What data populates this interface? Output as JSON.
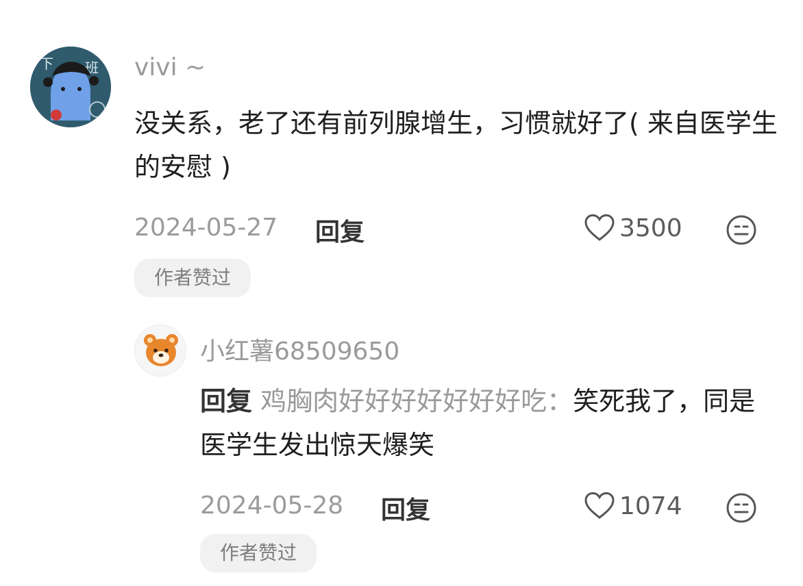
{
  "comments": [
    {
      "username": "vivi ~",
      "avatar_glyphs": [
        "下",
        "班"
      ],
      "text": "没关系，老了还有前列腺增生，习惯就好了( 来自医学生的安慰 )",
      "date": "2024-05-27",
      "reply_label": "回复",
      "likes": "3500",
      "badge": "作者赞过"
    }
  ],
  "replies": [
    {
      "username": "小红薯68509650",
      "reply_prefix": "回复",
      "reply_target": "鸡胸肉好好好好好好好吃：",
      "text": "笑死我了，同是医学生发出惊天爆笑",
      "date": "2024-05-28",
      "reply_label": "回复",
      "likes": "1074",
      "badge": "作者赞过"
    }
  ],
  "icons": {
    "like": "heart-outline-icon",
    "emoji": "neutral-face-icon"
  },
  "colors": {
    "text": "#1f1f1f",
    "muted": "#9a9a9a",
    "badge_bg": "#f1f1f1",
    "avatar_bg": "#2f5b6d",
    "avatar_figure": "#6fa0e8"
  }
}
